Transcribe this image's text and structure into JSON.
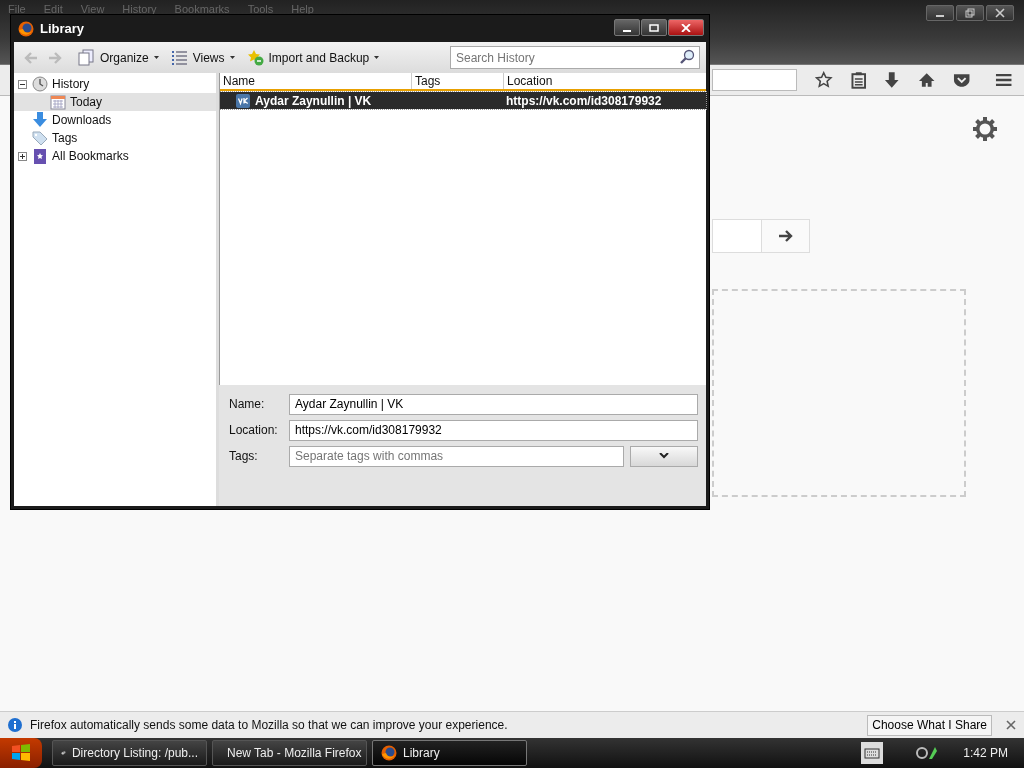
{
  "browser": {
    "menu": [
      "File",
      "Edit",
      "View",
      "History",
      "Bookmarks",
      "Tools",
      "Help"
    ]
  },
  "library": {
    "title": "Library",
    "toolbar": {
      "buttons": [
        {
          "label": "Organize",
          "kind": "organize"
        },
        {
          "label": "Views",
          "kind": "views"
        },
        {
          "label": "Import and Backup",
          "kind": "import"
        }
      ],
      "search": {
        "placeholder": "Search History"
      }
    },
    "sidebar": {
      "items": [
        {
          "label": "History",
          "kind": "history",
          "expanded": true,
          "selected": false,
          "children": [
            {
              "label": "Today",
              "kind": "day",
              "selected": true
            }
          ]
        },
        {
          "label": "Downloads",
          "kind": "downloads",
          "selected": false
        },
        {
          "label": "Tags",
          "kind": "tags",
          "selected": false
        },
        {
          "label": "All Bookmarks",
          "kind": "bookmarks",
          "expanded": false,
          "selected": false
        }
      ]
    },
    "table": {
      "columns": [
        "Name",
        "Tags",
        "Location"
      ],
      "rows": [
        {
          "name": "Aydar Zaynullin | VK",
          "location": "https://vk.com/id308179932",
          "selected": true
        }
      ]
    },
    "details": {
      "fields": [
        {
          "label": "Name:",
          "value": "Aydar Zaynullin | VK"
        },
        {
          "label": "Location:",
          "value": "https://vk.com/id308179932"
        },
        {
          "label": "Tags:",
          "placeholder": "Separate tags with commas",
          "kind": "tags"
        }
      ]
    }
  },
  "notification": {
    "text": "Firefox automatically sends some data to Mozilla so that we can improve your experience.",
    "button": "Choose What I Share"
  },
  "taskbar": {
    "tasks": [
      {
        "label": "Directory Listing: /pub...",
        "kind": "folder",
        "selected": false
      },
      {
        "label": "New Tab - Mozilla Firefox",
        "kind": "firefox",
        "selected": false
      },
      {
        "label": "Library",
        "kind": "firefox",
        "selected": true
      }
    ],
    "clock": "1:42 PM"
  }
}
